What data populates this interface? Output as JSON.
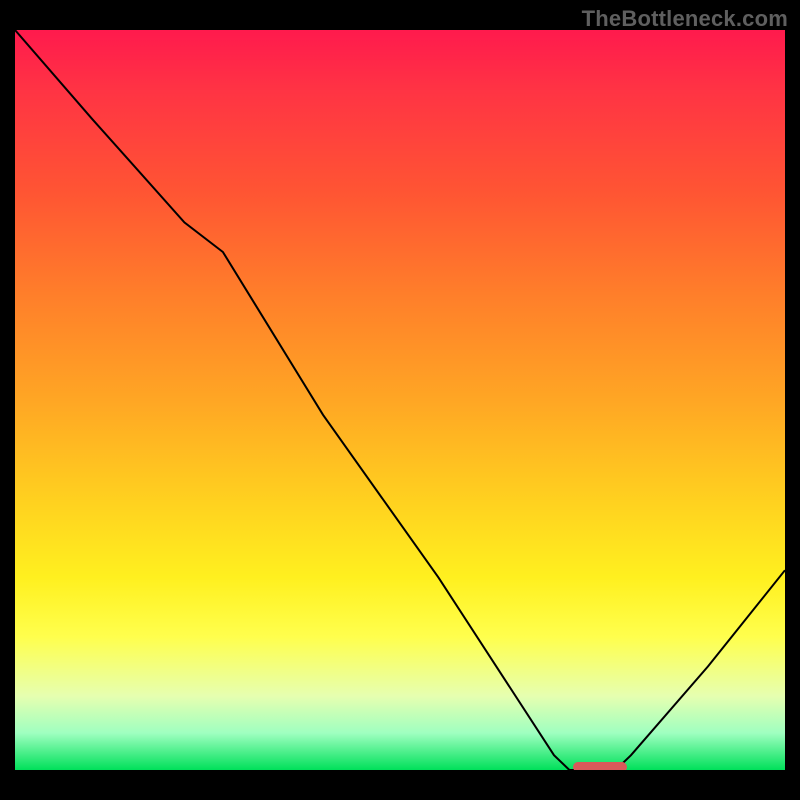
{
  "watermark": "TheBottleneck.com",
  "chart_data": {
    "type": "line",
    "title": "",
    "xlabel": "",
    "ylabel": "",
    "xlim": [
      0,
      100
    ],
    "ylim": [
      0,
      100
    ],
    "x": [
      0,
      10,
      22,
      27,
      40,
      55,
      70,
      72,
      78,
      80,
      90,
      100
    ],
    "values": [
      100,
      88,
      74,
      70,
      48,
      26,
      2,
      0,
      0,
      2,
      14,
      27
    ],
    "marker_x_range": [
      72.5,
      79.5
    ],
    "marker_y": 0.4,
    "gradient_top_color": "#ff1a4d",
    "gradient_bottom_color": "#00e05a",
    "curve_color": "#000000",
    "marker_color": "#d85a5a"
  }
}
